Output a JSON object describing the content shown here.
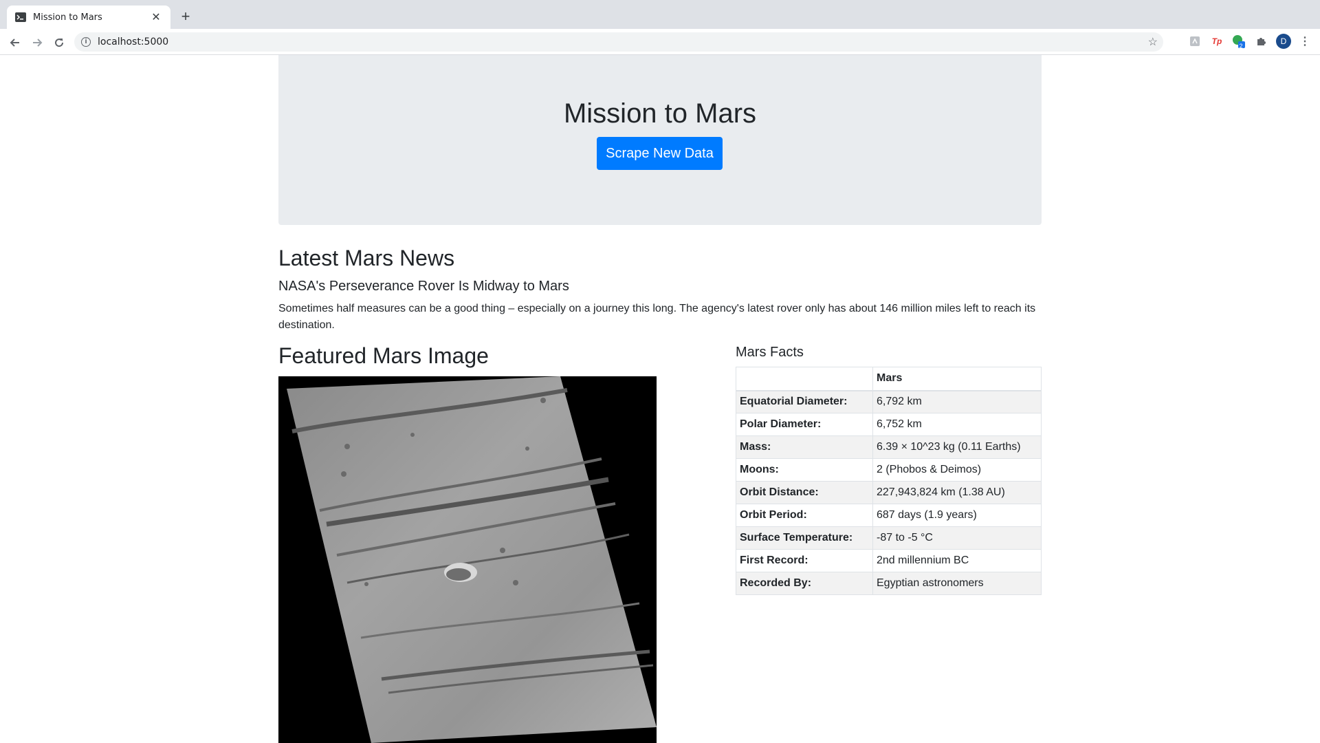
{
  "browser": {
    "tab_title": "Mission to Mars",
    "url": "localhost:5000",
    "profile_initial": "D",
    "ext_badge": "2",
    "ext_tp": "Tp"
  },
  "header": {
    "title": "Mission to Mars",
    "button_label": "Scrape New Data"
  },
  "news": {
    "heading": "Latest Mars News",
    "title": "NASA's Perseverance Rover Is Midway to Mars",
    "paragraph": "Sometimes half measures can be a good thing – especially on a journey this long. The agency's latest rover only has about 146 million miles left to reach its destination."
  },
  "featured_image": {
    "heading": "Featured Mars Image"
  },
  "facts": {
    "heading": "Mars Facts",
    "column_header": "Mars",
    "rows": [
      {
        "label": "Equatorial Diameter:",
        "value": "6,792 km"
      },
      {
        "label": "Polar Diameter:",
        "value": "6,752 km"
      },
      {
        "label": "Mass:",
        "value": "6.39 × 10^23 kg (0.11 Earths)"
      },
      {
        "label": "Moons:",
        "value": "2 (Phobos & Deimos)"
      },
      {
        "label": "Orbit Distance:",
        "value": "227,943,824 km (1.38 AU)"
      },
      {
        "label": "Orbit Period:",
        "value": "687 days (1.9 years)"
      },
      {
        "label": "Surface Temperature:",
        "value": "-87 to -5 °C"
      },
      {
        "label": "First Record:",
        "value": "2nd millennium BC"
      },
      {
        "label": "Recorded By:",
        "value": "Egyptian astronomers"
      }
    ]
  },
  "colors": {
    "primary": "#007bff",
    "jumbotron_bg": "#e9ecef",
    "text": "#212529"
  }
}
